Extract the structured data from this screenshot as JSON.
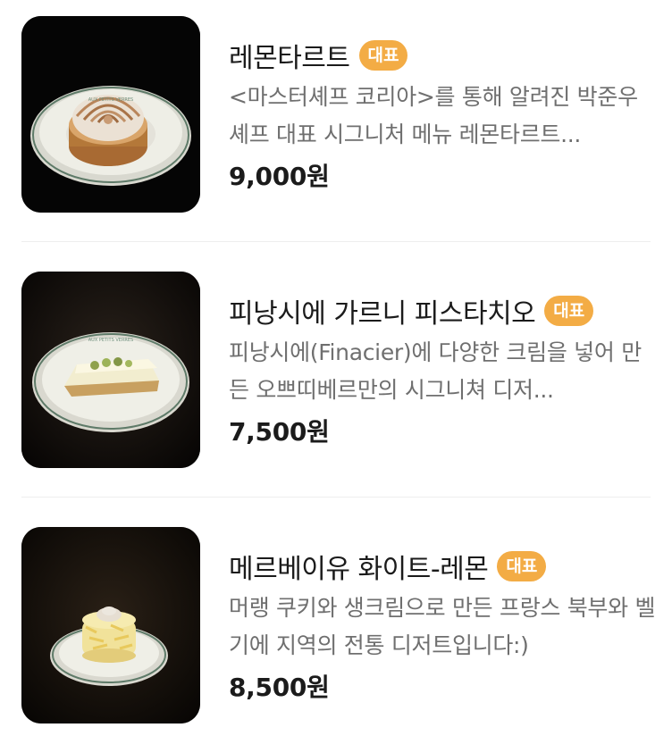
{
  "menu": {
    "items": [
      {
        "name": "레몬타르트",
        "badge": "대표",
        "description": "<마스터셰프 코리아>를 통해 알려진 박준우 셰프 대표 시그니처 메뉴 레몬타르트...",
        "price": "9,000원",
        "image_icon": "lemon-tart-photo"
      },
      {
        "name": "피낭시에 가르니 피스타치오",
        "badge": "대표",
        "description": "피낭시에(Finacier)에 다양한 크림을 넣어 만든 오쁘띠베르만의 시그니쳐 디저...",
        "price": "7,500원",
        "image_icon": "financier-photo"
      },
      {
        "name": "메르베이유 화이트-레몬",
        "badge": "대표",
        "description": "머랭 쿠키와 생크림으로 만든 프랑스 북부와 벨기에 지역의 전통 디저트입니다:)",
        "price": "8,500원",
        "image_icon": "merveilleux-photo"
      }
    ]
  },
  "colors": {
    "badge": "#f3ac45",
    "title": "#1b1b1b",
    "description": "#6f6f6f",
    "divider": "#eeeeee"
  }
}
